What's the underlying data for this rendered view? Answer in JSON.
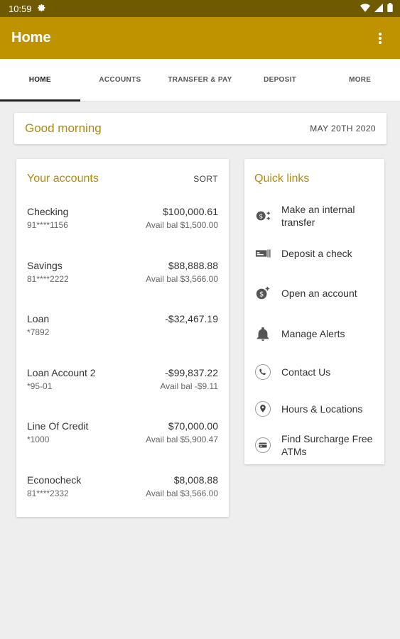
{
  "status": {
    "time": "10:59"
  },
  "app_bar": {
    "title": "Home"
  },
  "tabs": [
    {
      "label": "HOME"
    },
    {
      "label": "ACCOUNTS"
    },
    {
      "label": "TRANSFER & PAY"
    },
    {
      "label": "DEPOSIT"
    },
    {
      "label": "MORE"
    }
  ],
  "greeting": {
    "text": "Good morning",
    "date": "MAY 20TH 2020"
  },
  "accounts": {
    "title": "Your accounts",
    "sort_label": "SORT",
    "items": [
      {
        "name": "Checking",
        "number": "91****1156",
        "balance": "$100,000.61",
        "available": "Avail bal $1,500.00"
      },
      {
        "name": "Savings",
        "number": "81****2222",
        "balance": "$88,888.88",
        "available": "Avail bal $3,566.00"
      },
      {
        "name": "Loan",
        "number": "*7892",
        "balance": "-$32,467.19",
        "available": ""
      },
      {
        "name": "Loan Account 2",
        "number": "*95-01",
        "balance": "-$99,837.22",
        "available": "Avail bal -$9.11"
      },
      {
        "name": "Line Of Credit",
        "number": "*1000",
        "balance": "$70,000.00",
        "available": "Avail bal $5,900.47"
      },
      {
        "name": "Econocheck",
        "number": "81****2332",
        "balance": "$8,008.88",
        "available": "Avail bal $3,566.00"
      }
    ]
  },
  "quick_links": {
    "title": "Quick links",
    "items": [
      {
        "label": "Make an internal transfer",
        "icon": "transfer-icon"
      },
      {
        "label": "Deposit a check",
        "icon": "check-icon"
      },
      {
        "label": "Open an account",
        "icon": "add-money-icon"
      },
      {
        "label": "Manage Alerts",
        "icon": "bell-icon"
      },
      {
        "label": "Contact Us",
        "icon": "phone-icon"
      },
      {
        "label": "Hours & Locations",
        "icon": "location-pin-icon"
      },
      {
        "label": "Find Surcharge Free ATMs",
        "icon": "atm-card-icon"
      }
    ]
  },
  "colors": {
    "brand": "#bf9300",
    "status_bar": "#6f5a00",
    "accent_text": "#b18a10"
  }
}
